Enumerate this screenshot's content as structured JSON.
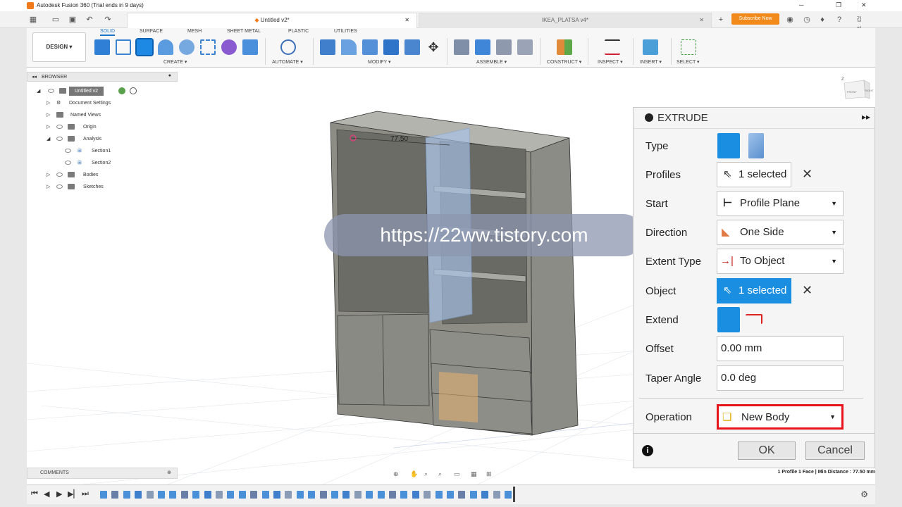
{
  "window": {
    "title": "Autodesk Fusion 360 (Trial ends in 9 days)",
    "tabs": [
      {
        "label": "Untitled v2*",
        "active": true
      },
      {
        "label": "IKEA_PLATSA v4*",
        "active": false
      }
    ],
    "subscribe_label": "Subscribe Now",
    "user_label": "김지"
  },
  "toolbar": {
    "workspace": "DESIGN ▾",
    "tabs": [
      "SOLID",
      "SURFACE",
      "MESH",
      "SHEET METAL",
      "PLASTIC",
      "UTILITIES"
    ],
    "groups": [
      "CREATE ▾",
      "AUTOMATE ▾",
      "MODIFY ▾",
      "ASSEMBLE ▾",
      "CONSTRUCT ▾",
      "INSPECT ▾",
      "INSERT ▾",
      "SELECT ▾"
    ]
  },
  "browser": {
    "header": "BROWSER",
    "root": "Untitled v2",
    "items": [
      "Document Settings",
      "Named Views",
      "Origin",
      "Analysis",
      "Section1",
      "Section2",
      "Bodies",
      "Sketches"
    ]
  },
  "viewport": {
    "dimension": "77.50",
    "watermark": "https://22ww.tistory.com",
    "viewcube_labels": [
      "Z",
      "FRONT",
      "RIGHT"
    ]
  },
  "extrude": {
    "title": "EXTRUDE",
    "rows": {
      "type": "Type",
      "profiles": "Profiles",
      "profiles_value": "1 selected",
      "start": "Start",
      "start_value": "Profile Plane",
      "direction": "Direction",
      "direction_value": "One Side",
      "extent_type": "Extent Type",
      "extent_value": "To Object",
      "object": "Object",
      "object_value": "1 selected",
      "extend": "Extend",
      "offset": "Offset",
      "offset_value": "0.00 mm",
      "taper": "Taper Angle",
      "taper_value": "0.0 deg",
      "operation": "Operation",
      "operation_value": "New Body"
    },
    "ok": "OK",
    "cancel": "Cancel",
    "accent": "#1a8ee0",
    "highlight": "#e8141c"
  },
  "comments": {
    "label": "COMMENTS"
  },
  "status": {
    "text": "1 Profile 1 Face | Min Distance : 77.50 mm"
  }
}
